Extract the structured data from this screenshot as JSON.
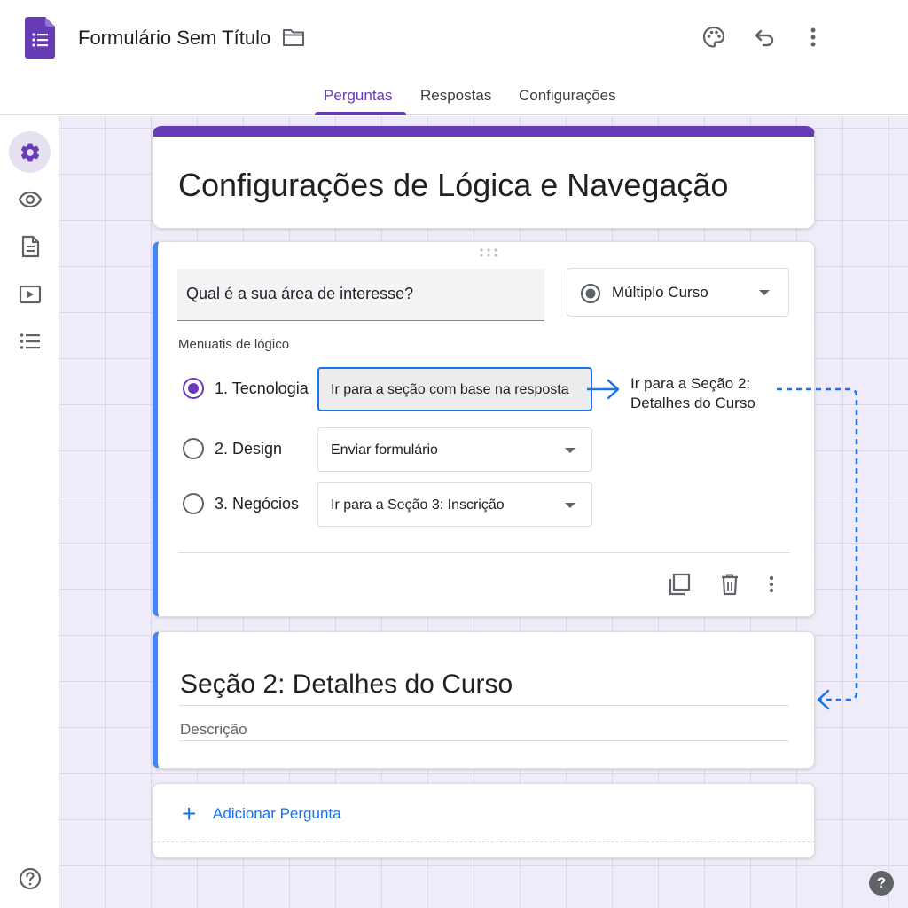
{
  "app": {
    "title": "Formulário Sem Título",
    "logo_icon": "forms-logo-icon",
    "accent_color": "#673ab7",
    "link_color": "#1a73e8"
  },
  "header": {
    "icons": [
      "folder-icon",
      "palette-icon",
      "undo-icon",
      "more-vert-icon"
    ],
    "tabs": [
      {
        "label": "Perguntas",
        "active": true
      },
      {
        "label": "Respostas",
        "active": false
      },
      {
        "label": "Configurações",
        "active": false
      }
    ]
  },
  "sidebar": {
    "icons": [
      "settings-icon",
      "preview-eye-icon",
      "document-icon",
      "play-icon",
      "list-icon"
    ],
    "help_icon": "help-icon"
  },
  "form": {
    "title": "Configurações de Lógica e Navegação"
  },
  "question": {
    "text": "Qual é a sua área de interesse?",
    "type": "Múltiplo Curso",
    "logic_label": "Menuatis de lógico",
    "options": [
      {
        "label": "1. Tecnologia",
        "selected": true,
        "destination": "Ir para a seção com base na resposta"
      },
      {
        "label": "2. Design",
        "selected": false,
        "destination": "Enviar formulário"
      },
      {
        "label": "3. Negócios",
        "selected": false,
        "destination": "Ir para a Seção 3: Inscrição"
      }
    ],
    "jump_annotation_line1": "Ir para a Seção 2:",
    "jump_annotation_line2": "Detalhes do Curso",
    "action_icons": [
      "duplicate-icon",
      "delete-icon",
      "more-vert-icon"
    ]
  },
  "section": {
    "title": "Seção 2: Detalhes do Curso",
    "description_placeholder": "Descrição"
  },
  "add_question": {
    "label": "Adicionar Pergunta",
    "icon": "plus-icon"
  },
  "help": {
    "right_label": "?"
  }
}
